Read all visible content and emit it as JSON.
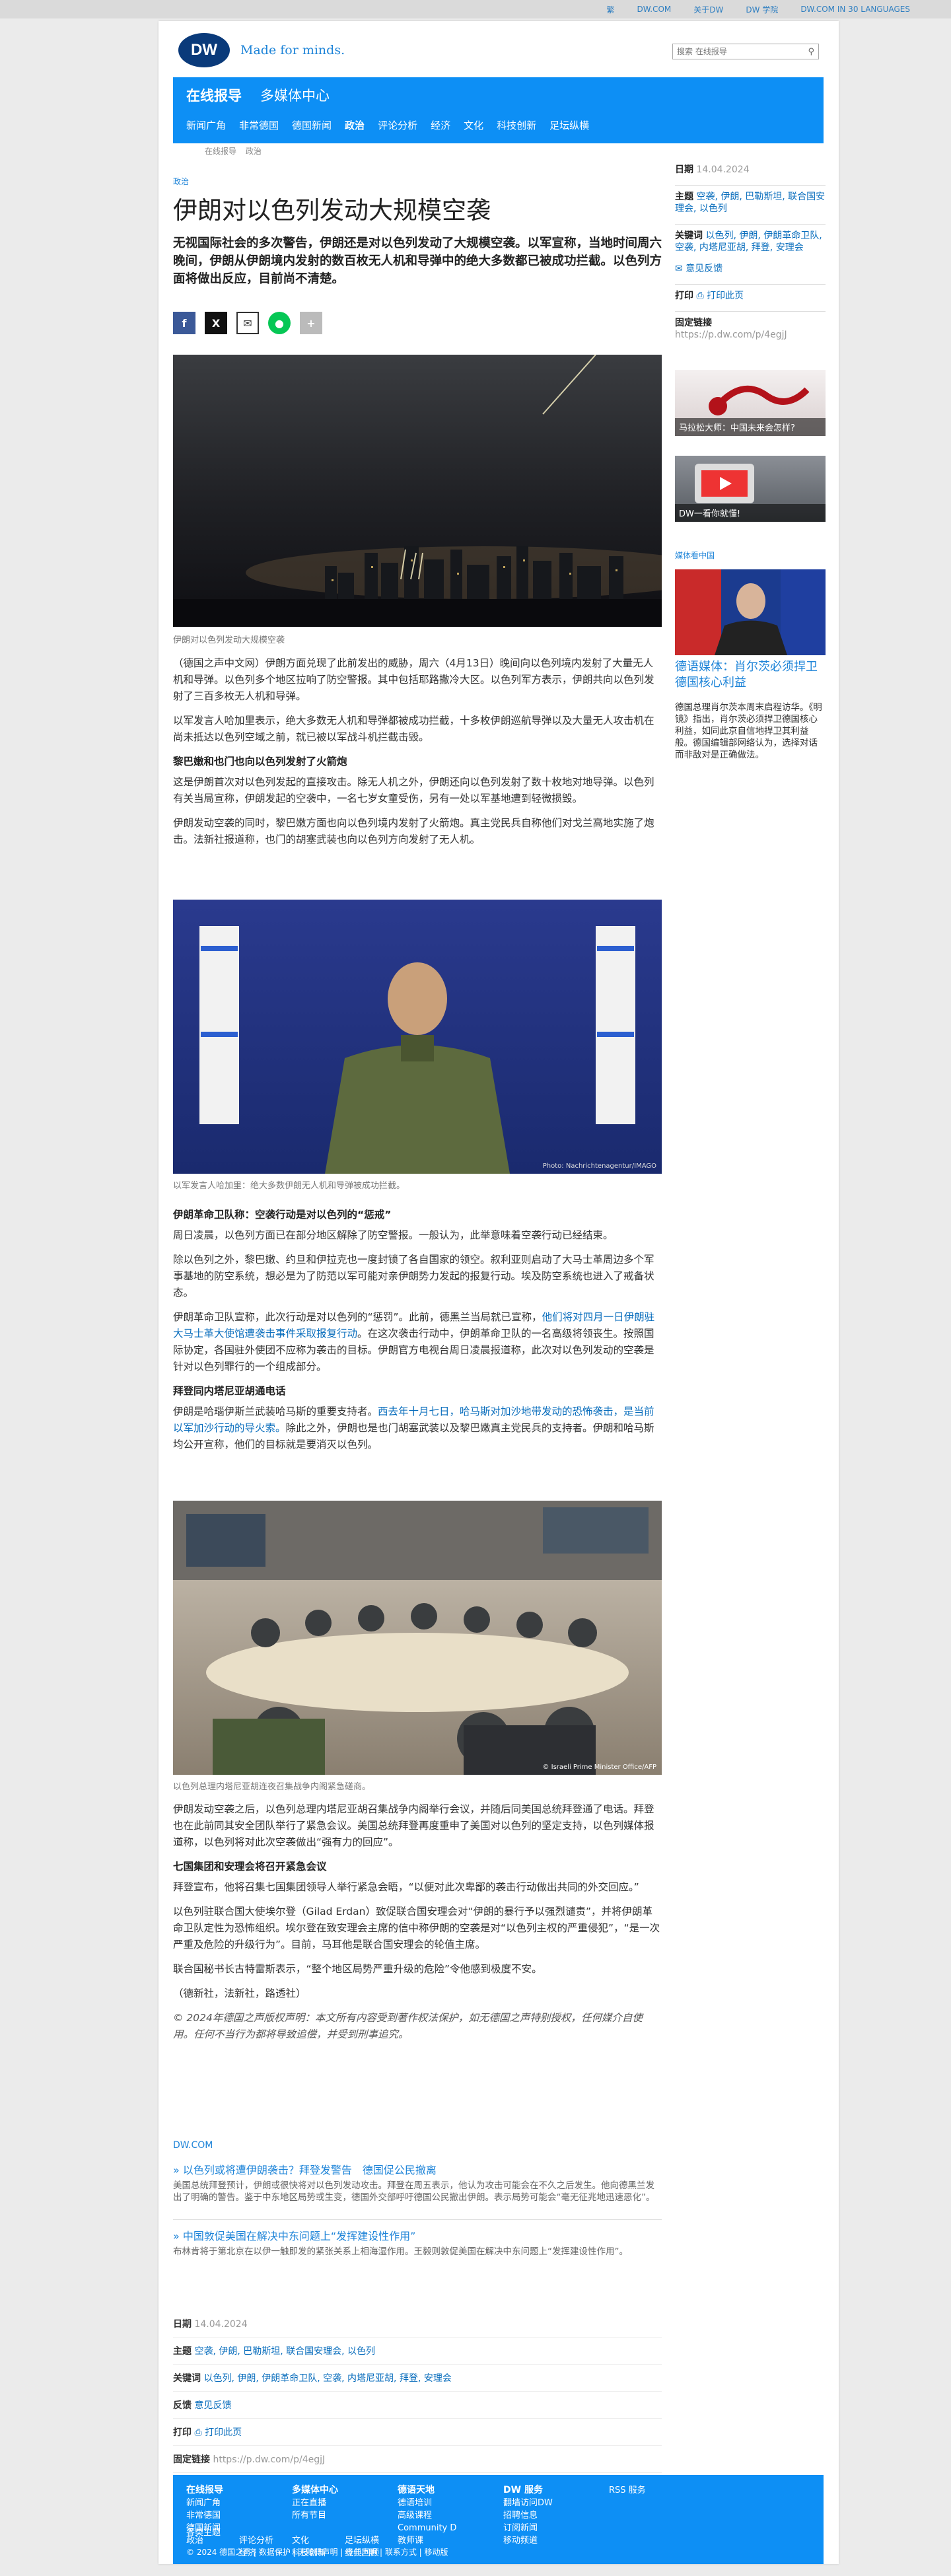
{
  "topbar": [
    "繁",
    "DW.COM",
    "关于DW",
    "DW 学院",
    "DW.COM IN 30 LANGUAGES"
  ],
  "brand": {
    "logo": "DW",
    "slogan": "Made for minds."
  },
  "search": {
    "placeholder": "搜索 在线报导",
    "icon": "search-icon"
  },
  "header": {
    "title": "在线报导",
    "title2": "多媒体中心",
    "nav": [
      "新闻广角",
      "非常德国",
      "德国新闻",
      "政治",
      "评论分析",
      "经济",
      "文化",
      "科技创新",
      "足坛纵横"
    ]
  },
  "breadcrumb": [
    "在线报导",
    "政治"
  ],
  "article": {
    "kicker": "政治",
    "title": "伊朗对以色列发动大规模空袭",
    "lead": "无视国际社会的多次警告，伊朗还是对以色列发动了大规模空袭。以军宣称，当地时间周六晚间，伊朗从伊朗境内发射的数百枚无人机和导弹中的绝大多数都已被成功拦截。以色列方面将做出反应，目前尚不清楚。",
    "caption1": "伊朗对以色列发动大规模空袭",
    "p1": "（德国之声中文网）伊朗方面兑现了此前发出的威胁，周六（4月13日）晚间向以色列境内发射了大量无人机和导弹。以色列多个地区拉响了防空警报。其中包括耶路撒冷大区。以色列军方表示，伊朗共向以色列发射了三百多枚无人机和导弹。",
    "p2": "以军发言人哈加里表示，绝大多数无人机和导弹都被成功拦截，十多枚伊朗巡航导弹以及大量无人攻击机在尚未抵达以色列空域之前，就已被以军战斗机拦截击毁。",
    "h1": "黎巴嫩和也门也向以色列发射了火箭炮",
    "p3": "这是伊朗首次对以色列发起的直接攻击。除无人机之外，伊朗还向以色列发射了数十枚地对地导弹。以色列有关当局宣称，伊朗发起的空袭中，一名七岁女童受伤，另有一处以军基地遭到轻微损毁。",
    "p4": "伊朗发动空袭的同时，黎巴嫩方面也向以色列境内发射了火箭炮。真主党民兵自称他们对戈兰高地实施了炮击。法新社报道称，也门的胡塞武装也向以色列方向发射了无人机。",
    "caption2": "以军发言人哈加里：绝大多数伊朗无人机和导弹被成功拦截。",
    "credit2": "Photo: Nachrichtenagentur/IMAGO",
    "h2": "伊朗革命卫队称：空袭行动是对以色列的“惩戒”",
    "p5": "周日凌晨，以色列方面已在部分地区解除了防空警报。一般认为，此举意味着空袭行动已经结束。",
    "p6": "除以色列之外，黎巴嫩、约旦和伊拉克也一度封锁了各自国家的领空。叙利亚则启动了大马士革周边多个军事基地的防空系统，想必是为了防范以军可能对亲伊朗势力发起的报复行动。埃及防空系统也进入了戒备状态。",
    "p7a": "伊朗革命卫队宣称，此次行动是对以色列的“惩罚”。此前，德黑兰当局就已宣称，",
    "p7link": "他们将对四月一日伊朗驻大马士革大使馆遭袭击事件采取报复行动",
    "p7b": "。在这次袭击行动中，伊朗革命卫队的一名高级将领丧生。按照国际协定，各国驻外使团不应称为袭击的目标。伊朗官方电视台周日凌晨报道称，此次对以色列发动的空袭是针对以色列罪行的一个组成部分。",
    "h3": "拜登同内塔尼亚胡通电话",
    "p8a": "伊朗是哈瑙伊斯兰武装哈马斯的重要支持者。",
    "p8link": "西去年十月七日，哈马斯对加沙地带发动的恐怖袭击，是当前以军加沙行动的导火索。",
    "p8b": "除此之外，伊朗也是也门胡塞武装以及黎巴嫩真主党民兵的支持者。伊朗和哈马斯均公开宣称，他们的目标就是要消灭以色列。",
    "caption3": "以色列总理内塔尼亚胡连夜召集战争内阁紧急磋商。",
    "credit3": "© Israeli Prime Minister Office/AFP",
    "p9": "伊朗发动空袭之后，以色列总理内塔尼亚胡召集战争内阁举行会议，并随后同美国总统拜登通了电话。拜登也在此前同其安全团队举行了紧急会议。美国总统拜登再度重申了美国对以色列的坚定支持，以色列媒体报道称，以色列将对此次空袭做出“强有力的回应”。",
    "h4": "七国集团和安理会将召开紧急会议",
    "p10": "拜登宣布，他将召集七国集团领导人举行紧急会晤，“以便对此次卑鄙的袭击行动做出共同的外交回应。”",
    "p11": "以色列驻联合国大使埃尔登（Gilad Erdan）致促联合国安理会对“伊朗的暴行予以强烈谴责”，并将伊朗革命卫队定性为恐怖组织。埃尔登在致安理会主席的信中称伊朗的空袭是对“以色列主权的严重侵犯”，“是一次严重及危险的升级行为”。目前，马耳他是联合国安理会的轮值主席。",
    "p12": "联合国秘书长古特雷斯表示，“整个地区局势严重升级的危险”令他感到极度不安。",
    "p13": "（德新社，法新社，路透社）",
    "copyright": "© 2024年德国之声版权声明：本文所有内容受到著作权法保护，如无德国之声特别授权，任何媒介自使用。任何不当行为都将导致追偿，并受到刑事追究。"
  },
  "aside": {
    "date_label": "日期",
    "date": "14.04.2024",
    "topic_label": "主题",
    "topics": "空袭, 伊朗, 巴勒斯坦, 联合国安理会, 以色列",
    "kw_label": "关键词",
    "keywords": "以色列, 伊朗, 伊朗革命卫队, 空袭, 内塔尼亚胡, 拜登, 安理会",
    "feedback": "意见反馈",
    "print_label": "打印",
    "print": "打印此页",
    "link_label": "固定链接",
    "link": "https://p.dw.com/p/4egjJ",
    "promo1": "马拉松大师：中国未来会怎样?",
    "promo2": "DW一看你就懂!",
    "media_label": "媒体看中国",
    "media_title": "德语媒体：肖尔茨必须捍卫德国核心利益",
    "media_text": "德国总理肖尔茨本周末启程访华。《明镜》指出，肖尔茨必须捍卫德国核心利益，如同此京自信地捍卫其利益般。德国编辑部网络认为，选择对话而非敌对是正确做法。"
  },
  "dwcom": "DW.COM",
  "related": [
    {
      "title": "以色列或将遭伊朗袭击？拜登发警告　德国促公民撤离",
      "desc": "美国总统拜登预计，伊朗或很快将对以色列发动攻击。拜登在周五表示，他认为攻击可能会在不久之后发生。他向德黑兰发出了明确的警告。鉴于中东地区局势或生变，德国外交部呼吁德国公民撤出伊朗。表示局势可能会“毫无征兆地迅速恶化”。"
    },
    {
      "title": "中国敦促美国在解决中东问题上“发挥建设性作用”",
      "desc": "布林肯将于第北京在以伊一触即发的紧张关系上相海湿作用。王毅则敦促美国在解决中东问题上“发挥建设性作用”。"
    }
  ],
  "meta2": {
    "date_label": "日期",
    "date": "14.04.2024",
    "topic_label": "主题",
    "topics": "空袭, 伊朗, 巴勒斯坦, 联合国安理会, 以色列",
    "kw_label": "关键词",
    "keywords": "以色列, 伊朗, 伊朗革命卫队, 空袭, 内塔尼亚胡, 拜登, 安理会",
    "fb_label": "反馈",
    "fb": "意见反馈",
    "print_label": "打印",
    "print": "打印此页",
    "link_label": "固定链接",
    "link": "https://p.dw.com/p/4egjJ"
  },
  "footer": {
    "col1": {
      "h": "在线报导",
      "items": [
        "新闻广角",
        "非常德国",
        "德国新闻",
        "政治",
        "评论分析",
        "经济",
        "文化",
        "科技创新",
        "足坛纵横",
        "经典回顾"
      ]
    },
    "col2": {
      "h": "多媒体中心",
      "items": [
        "正在直播",
        "所有节目"
      ]
    },
    "col3": {
      "h": "德语天地",
      "items": [
        "德语培训",
        "高级课程",
        "Community D",
        "教师课"
      ]
    },
    "col4": {
      "h": "DW 服务",
      "items": [
        "翻墙访问DW",
        "招聘信息",
        "订阅新闻",
        "移动频道",
        "RSS 服务"
      ]
    },
    "more": "各类主题",
    "bottom": "© 2024 德国之声 | 数据保护 | 无障碍声明 | 责任声明 | 联系方式 | 移动版"
  },
  "colors": {
    "brand_blue": "#0d8ff5",
    "link_blue": "#1e84d8",
    "logo_navy": "#0a3a7a"
  }
}
